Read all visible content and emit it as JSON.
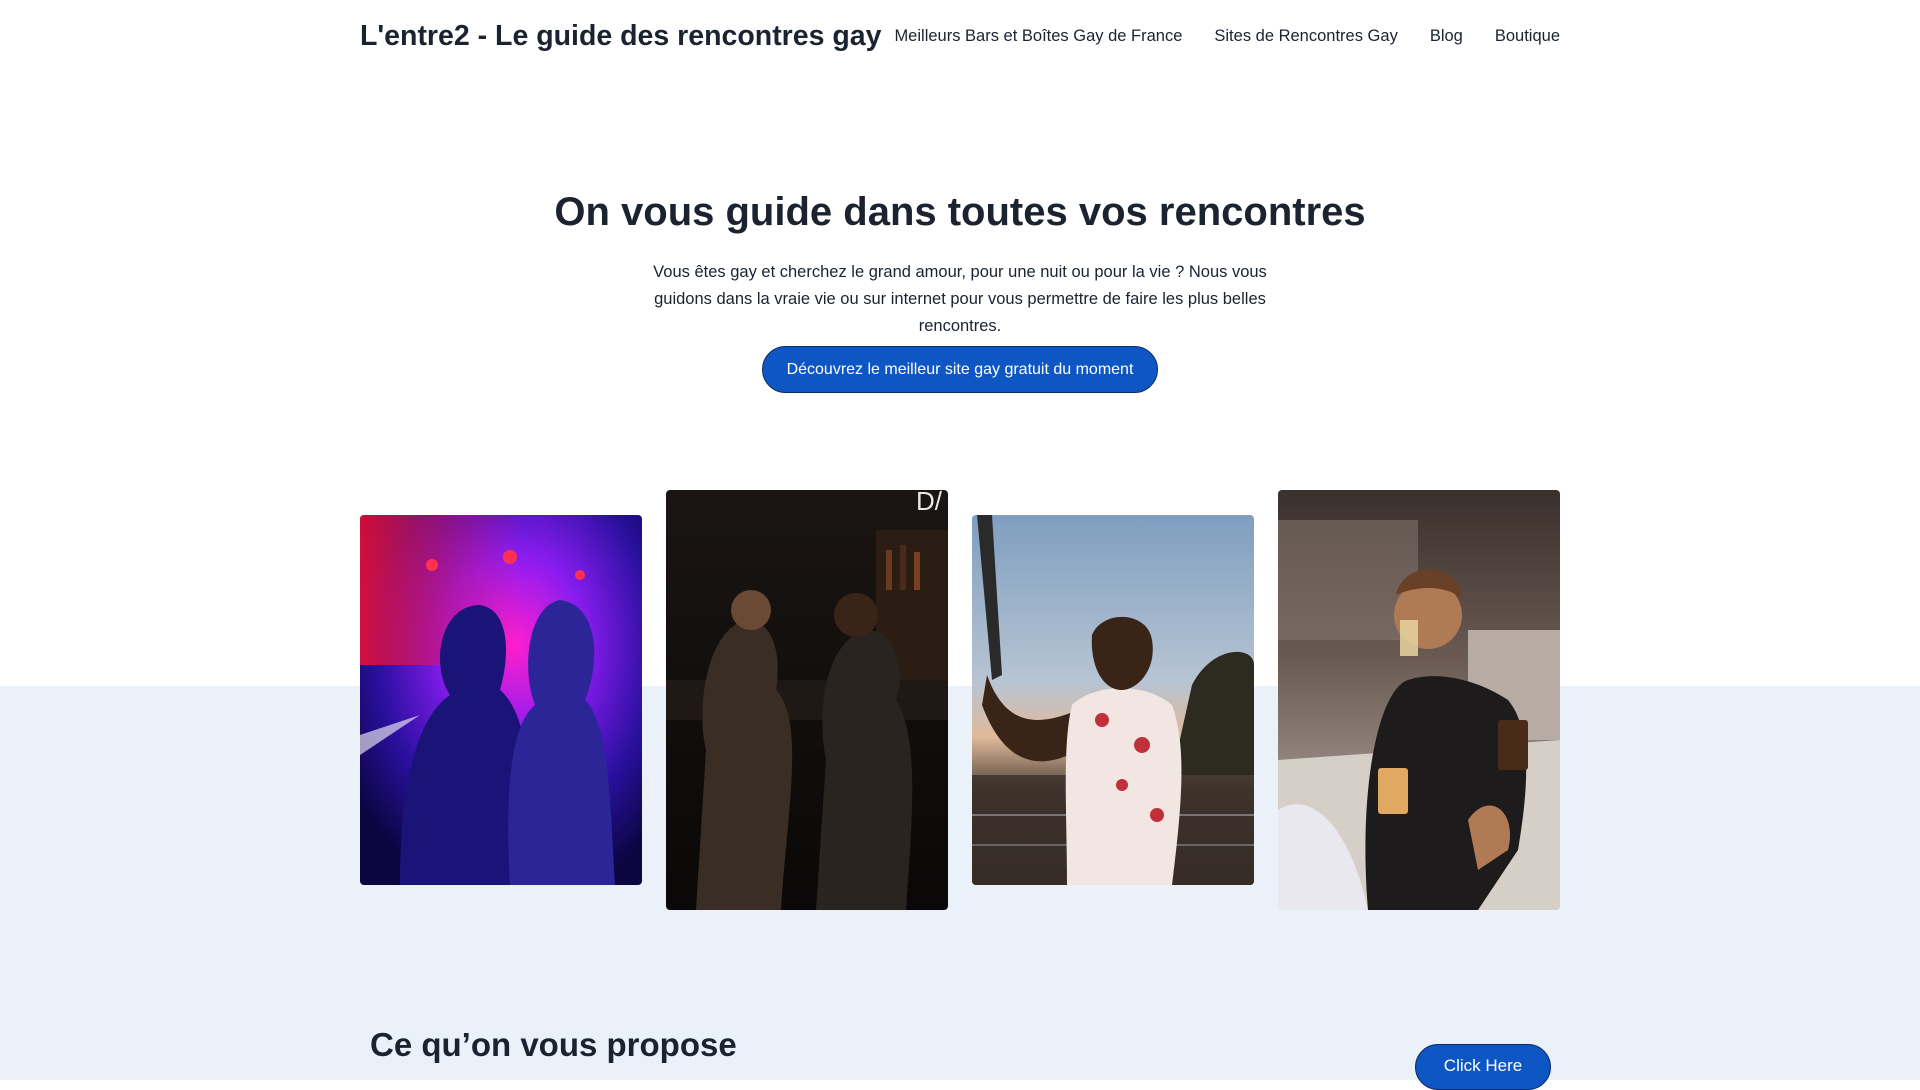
{
  "header": {
    "site_title": "L'entre2 - Le guide des rencontres gay",
    "nav": [
      {
        "label": "Meilleurs Bars et Boîtes Gay de France"
      },
      {
        "label": "Sites de Rencontres Gay"
      },
      {
        "label": "Blog"
      },
      {
        "label": "Boutique"
      }
    ]
  },
  "hero": {
    "title": "On vous guide dans toutes vos rencontres",
    "text": "Vous êtes gay et cherchez le grand amour, pour une nuit ou pour la vie ? Nous vous guidons dans la vraie vie ou sur internet pour vous permettre de faire les plus belles rencontres.",
    "cta_label": "Découvrez le meilleur site gay gratuit du moment"
  },
  "gallery": [
    {
      "icon": "club-kiss-photo"
    },
    {
      "icon": "bar-couple-photo"
    },
    {
      "icon": "selfie-sunset-photo"
    },
    {
      "icon": "bar-beer-photo"
    }
  ],
  "section": {
    "title": "Ce qu’on vous propose",
    "button_label": "Click Here"
  },
  "colors": {
    "accent": "#0d56c3",
    "band": "#ebf1f9",
    "text": "#1b2330"
  }
}
